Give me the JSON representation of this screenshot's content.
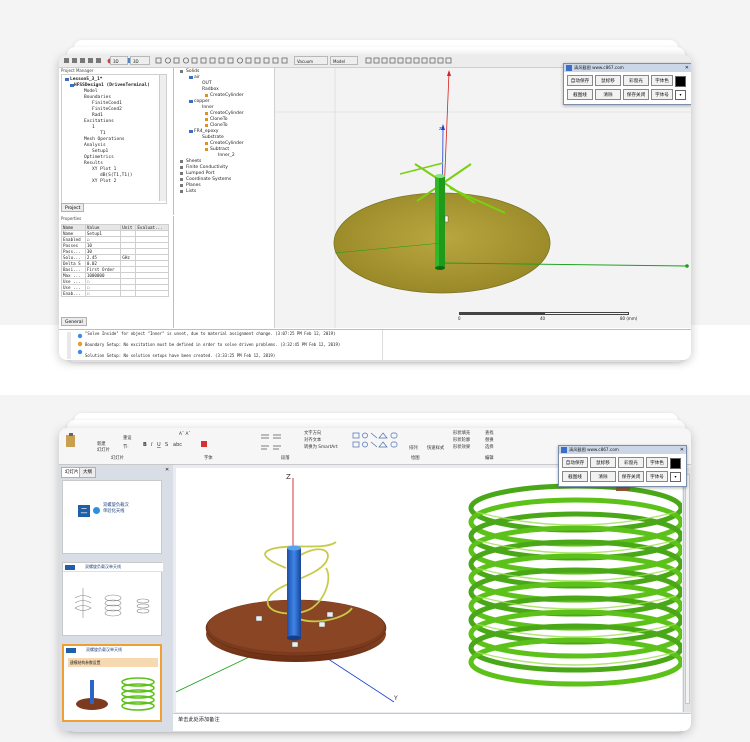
{
  "colors": {
    "page_bg": "#f4f4f5",
    "card_bg": "#ffffff",
    "hfss_viewport": "#f3f3f3",
    "ppt_ribbon": "#f6f6f6",
    "ppt_panel": "#d8dde6",
    "tool_title_bg": "#cbd6e6",
    "substrate_top": "#d8d8d8",
    "substrate_bottom": "#7c3b1e",
    "coil_green": "#5cc21a",
    "helix_yellow": "#c9c94a",
    "axis_red": "#d62020",
    "axis_blue": "#1c3fd0",
    "axis_green": "#18a018"
  },
  "hfss": {
    "toolbar": {
      "combo1": "3D",
      "combo2": "3D",
      "combo3": "Vacuum",
      "combo4": "Model"
    },
    "project_manager": {
      "header": "Project Manager",
      "items": [
        "Lesson5_3_1*",
        "HFSSDesign1 (DrivenTerminal)",
        "Model",
        "Boundaries",
        "FiniteCond1",
        "FiniteCond2",
        "Rad1",
        "Excitations",
        "1",
        "T1",
        "Mesh Operations",
        "Analysis",
        "Setup1",
        "Optimetrics",
        "Results",
        "XY Plot 1",
        "dB(S(T1,T1))",
        "XY Plot 2"
      ],
      "tab": "Project"
    },
    "model_tree": {
      "items": [
        "Solids",
        "air",
        "OUT",
        "Radbox",
        "CreateCylinder",
        "copper",
        "Inner",
        "CreateCylinder",
        "CloneTo",
        "CloneTo",
        "FR4_epoxy",
        "Substrate",
        "CreateCylinder",
        "Subtract",
        "Inner_2",
        "Sheets",
        "Finite Conductivity",
        "Lumped Port",
        "Coordinate Systems",
        "Planes",
        "Lists"
      ]
    },
    "properties": {
      "header": "Properties",
      "columns": [
        "Name",
        "Value",
        "Unit",
        "Evaluat..."
      ],
      "rows": [
        [
          "Name",
          "Setup1",
          "",
          ""
        ],
        [
          "Enabled",
          "☑",
          "",
          ""
        ],
        [
          "Passes",
          "10",
          "",
          ""
        ],
        [
          "Pass...",
          "30",
          "",
          ""
        ],
        [
          "Solu...",
          "2.45",
          "GHz",
          ""
        ],
        [
          "Delta S",
          "0.02",
          "",
          ""
        ],
        [
          "Basi...",
          "First Order",
          "",
          ""
        ],
        [
          "Max ...",
          "1000000",
          "",
          ""
        ],
        [
          "Use ...",
          "☐",
          "",
          ""
        ],
        [
          "Use ...",
          "☐",
          "",
          ""
        ],
        [
          "Enab...",
          "☐",
          "",
          ""
        ]
      ],
      "tab": "General"
    },
    "scale_ticks": [
      "0",
      "40",
      "80 (mm)"
    ],
    "messages": [
      "\"Solve Inside\" for object \"Inner\" is unset, due to material assignment change. (3:07:25 PM  Feb 12, 2019)",
      "Boundary Setup: No excitation must be defined in order to solve driven problems. (3:32:45 PM  Feb 12, 2019)",
      "Solution Setup: No solution setups have been created. (3:33:25 PM  Feb 12, 2019)"
    ],
    "tool": {
      "title": "清风截图 www.c867.com",
      "buttons": [
        "自动保存",
        "鼠标移",
        "彩窗光",
        "字体色",
        "截图线",
        "清除",
        "保存关闭",
        "字体号"
      ]
    }
  },
  "ppt": {
    "ribbon": {
      "fmt": "Aˇ Aˇ",
      "new_slide": "新建\n幻灯片",
      "reset": "重设",
      "section": "节·",
      "slides_label": "幻灯片",
      "font_label": "字体",
      "paragraph_label": "段落",
      "drawing_label": "绘图",
      "edit_label": "编辑",
      "text_dir": "文字方向",
      "align_text": "对齐文本",
      "smartart": "转换为 SmartArt",
      "arrange": "排列",
      "quick_styles": "快速样式",
      "shape_fill": "形状填充",
      "shape_outline": "形状轮廓",
      "shape_effect": "形状效果",
      "find": "查找",
      "replace": "替换",
      "select": "选择"
    },
    "tabs": [
      "幻灯片",
      "大纲"
    ],
    "slide1": {
      "number": "二",
      "title": "双螺旋负载汉\n单验化天线"
    },
    "slide2": {
      "title": "双螺旋负载汉单天线"
    },
    "slide3": {
      "title": "双螺旋负载汉单天线",
      "note": "建模结构参数设置"
    },
    "axis_z": "Z",
    "axis_y": "Y",
    "notes": "单击此处添加备注",
    "tool": {
      "title": "清风截图 www.c867.com",
      "buttons": [
        "自动保存",
        "鼠标移",
        "彩窗光",
        "字体色",
        "截图线",
        "清除",
        "保存关闭",
        "字体号"
      ]
    }
  }
}
